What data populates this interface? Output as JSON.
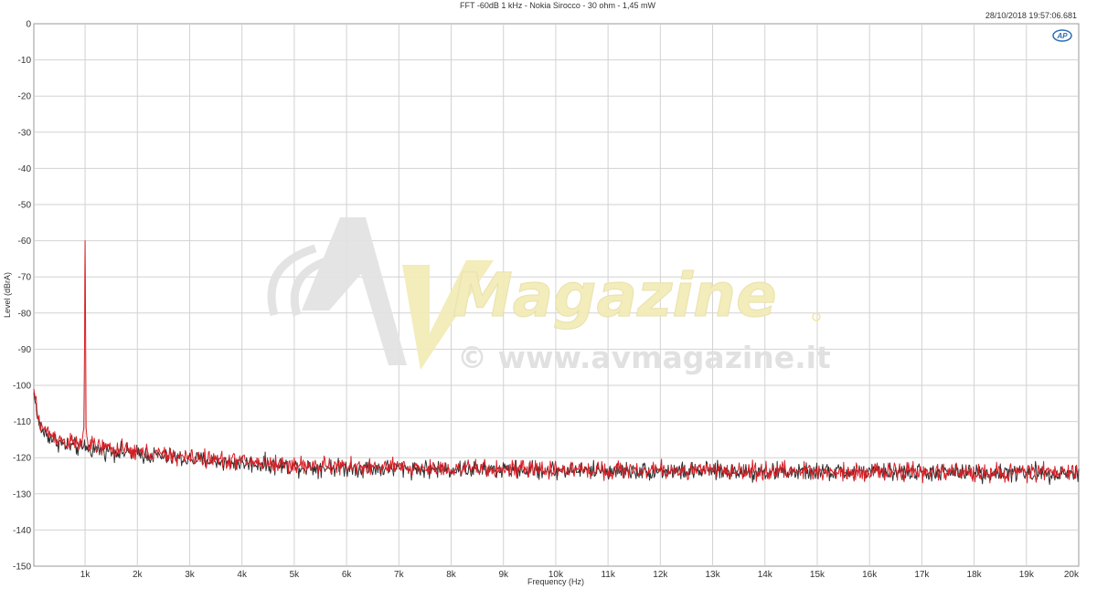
{
  "colors": {
    "background": "#ffffff",
    "grid": "#d2d2d2",
    "ch1": "#d81f26",
    "ch2": "#303030",
    "watermark_gray": "#dedede",
    "watermark_yellow": "#f3ecb8"
  },
  "logo": {
    "text": "AP"
  },
  "watermark": {
    "brand": "Magazine",
    "url": "© www.avmagazine.it",
    "logo_letters": "AV"
  },
  "chart_data": {
    "type": "line",
    "title": "FFT -60dB 1 kHz - Nokia Sirocco - 30 ohm - 1,45 mW",
    "timestamp": "28/10/2018 19:57:06.681",
    "xlabel": "Frequency (Hz)",
    "ylabel": "Level (dBrA)",
    "xlim": [
      20,
      20000
    ],
    "ylim": [
      -150,
      0
    ],
    "grid": true,
    "x_ticks": [
      {
        "v": 1000,
        "label": "1k"
      },
      {
        "v": 2000,
        "label": "2k"
      },
      {
        "v": 3000,
        "label": "3k"
      },
      {
        "v": 4000,
        "label": "4k"
      },
      {
        "v": 5000,
        "label": "5k"
      },
      {
        "v": 6000,
        "label": "6k"
      },
      {
        "v": 7000,
        "label": "7k"
      },
      {
        "v": 8000,
        "label": "8k"
      },
      {
        "v": 9000,
        "label": "9k"
      },
      {
        "v": 10000,
        "label": "10k"
      },
      {
        "v": 11000,
        "label": "11k"
      },
      {
        "v": 12000,
        "label": "12k"
      },
      {
        "v": 13000,
        "label": "13k"
      },
      {
        "v": 14000,
        "label": "14k"
      },
      {
        "v": 15000,
        "label": "15k"
      },
      {
        "v": 16000,
        "label": "16k"
      },
      {
        "v": 17000,
        "label": "17k"
      },
      {
        "v": 18000,
        "label": "18k"
      },
      {
        "v": 19000,
        "label": "19k"
      },
      {
        "v": 20000,
        "label": "20k"
      }
    ],
    "y_ticks": [
      {
        "v": 0,
        "label": "0"
      },
      {
        "v": -10,
        "label": "-10"
      },
      {
        "v": -20,
        "label": "-20"
      },
      {
        "v": -30,
        "label": "-30"
      },
      {
        "v": -40,
        "label": "-40"
      },
      {
        "v": -50,
        "label": "-50"
      },
      {
        "v": -60,
        "label": "-60"
      },
      {
        "v": -70,
        "label": "-70"
      },
      {
        "v": -80,
        "label": "-80"
      },
      {
        "v": -90,
        "label": "-90"
      },
      {
        "v": -100,
        "label": "-100"
      },
      {
        "v": -110,
        "label": "-110"
      },
      {
        "v": -120,
        "label": "-120"
      },
      {
        "v": -130,
        "label": "-130"
      },
      {
        "v": -140,
        "label": "-140"
      },
      {
        "v": -150,
        "label": "-150"
      }
    ],
    "series": [
      {
        "color": "#303030",
        "x": [
          20,
          100,
          200,
          400,
          600,
          800,
          950,
          1000,
          1050,
          1500,
          2000,
          3000,
          4000,
          5000,
          6000,
          7000,
          8000,
          9000,
          10000,
          11000,
          12000,
          13000,
          14000,
          15000,
          16000,
          17000,
          18000,
          19000,
          20000
        ],
        "y": [
          -102,
          -110,
          -113,
          -115,
          -116.5,
          -117,
          -117.5,
          -116.5,
          -117.5,
          -118,
          -119,
          -120.5,
          -121.5,
          -122.5,
          -122.8,
          -123,
          -123.2,
          -123.4,
          -123.5,
          -123.6,
          -123.7,
          -123.8,
          -123.9,
          -124,
          -124,
          -124.1,
          -124.2,
          -124.2,
          -124.3
        ]
      },
      {
        "color": "#d81f26",
        "x": [
          20,
          100,
          200,
          400,
          600,
          800,
          950,
          985,
          995,
          1000,
          1005,
          1015,
          1050,
          1500,
          2000,
          3000,
          4000,
          5000,
          6000,
          7000,
          8000,
          9000,
          10000,
          11000,
          12000,
          13000,
          14000,
          15000,
          16000,
          17000,
          18000,
          19000,
          20000
        ],
        "y": [
          -101,
          -109,
          -112,
          -114,
          -115.5,
          -116,
          -116.5,
          -110,
          -70,
          -60,
          -70,
          -112,
          -116.5,
          -117.5,
          -118.5,
          -120,
          -121,
          -122,
          -122.5,
          -122.8,
          -123,
          -123.2,
          -123.3,
          -123.4,
          -123.5,
          -123.6,
          -123.7,
          -123.8,
          -123.9,
          -124,
          -124,
          -124.1,
          -124.2
        ]
      }
    ]
  }
}
